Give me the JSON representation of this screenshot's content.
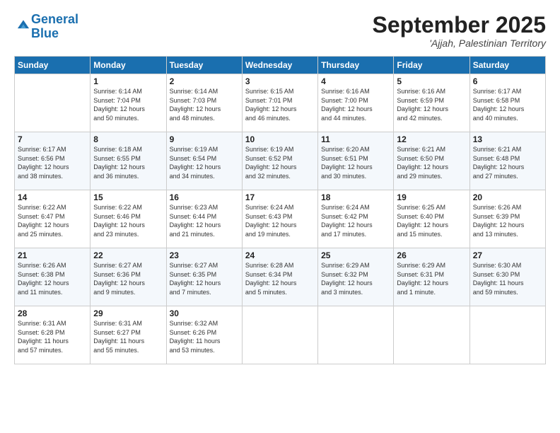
{
  "logo": {
    "text1": "General",
    "text2": "Blue"
  },
  "title": "September 2025",
  "subtitle": "'Ajjah, Palestinian Territory",
  "days_of_week": [
    "Sunday",
    "Monday",
    "Tuesday",
    "Wednesday",
    "Thursday",
    "Friday",
    "Saturday"
  ],
  "weeks": [
    [
      {
        "day": "",
        "info": ""
      },
      {
        "day": "1",
        "info": "Sunrise: 6:14 AM\nSunset: 7:04 PM\nDaylight: 12 hours\nand 50 minutes."
      },
      {
        "day": "2",
        "info": "Sunrise: 6:14 AM\nSunset: 7:03 PM\nDaylight: 12 hours\nand 48 minutes."
      },
      {
        "day": "3",
        "info": "Sunrise: 6:15 AM\nSunset: 7:01 PM\nDaylight: 12 hours\nand 46 minutes."
      },
      {
        "day": "4",
        "info": "Sunrise: 6:16 AM\nSunset: 7:00 PM\nDaylight: 12 hours\nand 44 minutes."
      },
      {
        "day": "5",
        "info": "Sunrise: 6:16 AM\nSunset: 6:59 PM\nDaylight: 12 hours\nand 42 minutes."
      },
      {
        "day": "6",
        "info": "Sunrise: 6:17 AM\nSunset: 6:58 PM\nDaylight: 12 hours\nand 40 minutes."
      }
    ],
    [
      {
        "day": "7",
        "info": "Sunrise: 6:17 AM\nSunset: 6:56 PM\nDaylight: 12 hours\nand 38 minutes."
      },
      {
        "day": "8",
        "info": "Sunrise: 6:18 AM\nSunset: 6:55 PM\nDaylight: 12 hours\nand 36 minutes."
      },
      {
        "day": "9",
        "info": "Sunrise: 6:19 AM\nSunset: 6:54 PM\nDaylight: 12 hours\nand 34 minutes."
      },
      {
        "day": "10",
        "info": "Sunrise: 6:19 AM\nSunset: 6:52 PM\nDaylight: 12 hours\nand 32 minutes."
      },
      {
        "day": "11",
        "info": "Sunrise: 6:20 AM\nSunset: 6:51 PM\nDaylight: 12 hours\nand 30 minutes."
      },
      {
        "day": "12",
        "info": "Sunrise: 6:21 AM\nSunset: 6:50 PM\nDaylight: 12 hours\nand 29 minutes."
      },
      {
        "day": "13",
        "info": "Sunrise: 6:21 AM\nSunset: 6:48 PM\nDaylight: 12 hours\nand 27 minutes."
      }
    ],
    [
      {
        "day": "14",
        "info": "Sunrise: 6:22 AM\nSunset: 6:47 PM\nDaylight: 12 hours\nand 25 minutes."
      },
      {
        "day": "15",
        "info": "Sunrise: 6:22 AM\nSunset: 6:46 PM\nDaylight: 12 hours\nand 23 minutes."
      },
      {
        "day": "16",
        "info": "Sunrise: 6:23 AM\nSunset: 6:44 PM\nDaylight: 12 hours\nand 21 minutes."
      },
      {
        "day": "17",
        "info": "Sunrise: 6:24 AM\nSunset: 6:43 PM\nDaylight: 12 hours\nand 19 minutes."
      },
      {
        "day": "18",
        "info": "Sunrise: 6:24 AM\nSunset: 6:42 PM\nDaylight: 12 hours\nand 17 minutes."
      },
      {
        "day": "19",
        "info": "Sunrise: 6:25 AM\nSunset: 6:40 PM\nDaylight: 12 hours\nand 15 minutes."
      },
      {
        "day": "20",
        "info": "Sunrise: 6:26 AM\nSunset: 6:39 PM\nDaylight: 12 hours\nand 13 minutes."
      }
    ],
    [
      {
        "day": "21",
        "info": "Sunrise: 6:26 AM\nSunset: 6:38 PM\nDaylight: 12 hours\nand 11 minutes."
      },
      {
        "day": "22",
        "info": "Sunrise: 6:27 AM\nSunset: 6:36 PM\nDaylight: 12 hours\nand 9 minutes."
      },
      {
        "day": "23",
        "info": "Sunrise: 6:27 AM\nSunset: 6:35 PM\nDaylight: 12 hours\nand 7 minutes."
      },
      {
        "day": "24",
        "info": "Sunrise: 6:28 AM\nSunset: 6:34 PM\nDaylight: 12 hours\nand 5 minutes."
      },
      {
        "day": "25",
        "info": "Sunrise: 6:29 AM\nSunset: 6:32 PM\nDaylight: 12 hours\nand 3 minutes."
      },
      {
        "day": "26",
        "info": "Sunrise: 6:29 AM\nSunset: 6:31 PM\nDaylight: 12 hours\nand 1 minute."
      },
      {
        "day": "27",
        "info": "Sunrise: 6:30 AM\nSunset: 6:30 PM\nDaylight: 11 hours\nand 59 minutes."
      }
    ],
    [
      {
        "day": "28",
        "info": "Sunrise: 6:31 AM\nSunset: 6:28 PM\nDaylight: 11 hours\nand 57 minutes."
      },
      {
        "day": "29",
        "info": "Sunrise: 6:31 AM\nSunset: 6:27 PM\nDaylight: 11 hours\nand 55 minutes."
      },
      {
        "day": "30",
        "info": "Sunrise: 6:32 AM\nSunset: 6:26 PM\nDaylight: 11 hours\nand 53 minutes."
      },
      {
        "day": "",
        "info": ""
      },
      {
        "day": "",
        "info": ""
      },
      {
        "day": "",
        "info": ""
      },
      {
        "day": "",
        "info": ""
      }
    ]
  ]
}
